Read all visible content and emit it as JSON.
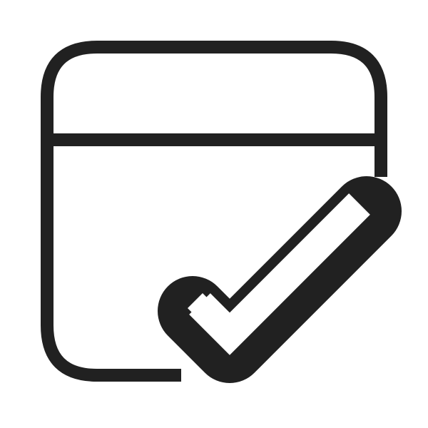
{
  "icon": {
    "name": "calendar-checkmark-icon",
    "stroke_color": "#212121",
    "fill_color": "#ffffff"
  }
}
